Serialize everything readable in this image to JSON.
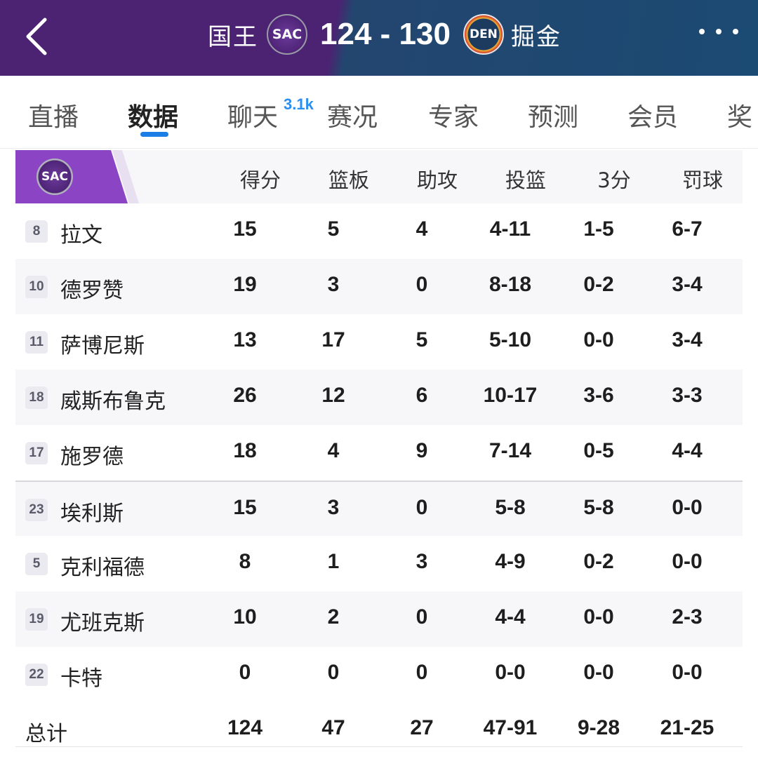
{
  "header": {
    "home_team": "国王",
    "home_logo": "SAC",
    "score": "124 - 130",
    "away_logo": "DEN",
    "away_team": "掘金",
    "colors": {
      "home_bg": "#4b2372",
      "away_bg": "#1b4a72"
    }
  },
  "tabs": [
    {
      "label": "直播"
    },
    {
      "label": "数据"
    },
    {
      "label": "聊天"
    },
    {
      "label": "赛况"
    },
    {
      "label": "专家"
    },
    {
      "label": "预测"
    },
    {
      "label": "会员"
    },
    {
      "label": "奖"
    }
  ],
  "chat_badge": "3.1k",
  "active_tab": "数据",
  "team_logo": "SAC",
  "columns": [
    "得分",
    "篮板",
    "助攻",
    "投篮",
    "3分",
    "罚球"
  ],
  "players": [
    {
      "num": "8",
      "name": "拉文",
      "stats": [
        "15",
        "5",
        "4",
        "4-11",
        "1-5",
        "6-7"
      ]
    },
    {
      "num": "10",
      "name": "德罗赞",
      "stats": [
        "19",
        "3",
        "0",
        "8-18",
        "0-2",
        "3-4"
      ]
    },
    {
      "num": "11",
      "name": "萨博尼斯",
      "stats": [
        "13",
        "17",
        "5",
        "5-10",
        "0-0",
        "3-4"
      ]
    },
    {
      "num": "18",
      "name": "威斯布鲁克",
      "stats": [
        "26",
        "12",
        "6",
        "10-17",
        "3-6",
        "3-3"
      ]
    },
    {
      "num": "17",
      "name": "施罗德",
      "stats": [
        "18",
        "4",
        "9",
        "7-14",
        "0-5",
        "4-4"
      ]
    },
    {
      "num": "23",
      "name": "埃利斯",
      "stats": [
        "15",
        "3",
        "0",
        "5-8",
        "5-8",
        "0-0"
      ]
    },
    {
      "num": "5",
      "name": "克利福德",
      "stats": [
        "8",
        "1",
        "3",
        "4-9",
        "0-2",
        "0-0"
      ]
    },
    {
      "num": "19",
      "name": "尤班克斯",
      "stats": [
        "10",
        "2",
        "0",
        "4-4",
        "0-0",
        "2-3"
      ]
    },
    {
      "num": "22",
      "name": "卡特",
      "stats": [
        "0",
        "0",
        "0",
        "0-0",
        "0-0",
        "0-0"
      ]
    }
  ],
  "totals": {
    "label": "总计",
    "stats": [
      "124",
      "47",
      "27",
      "47-91",
      "9-28",
      "21-25"
    ]
  }
}
